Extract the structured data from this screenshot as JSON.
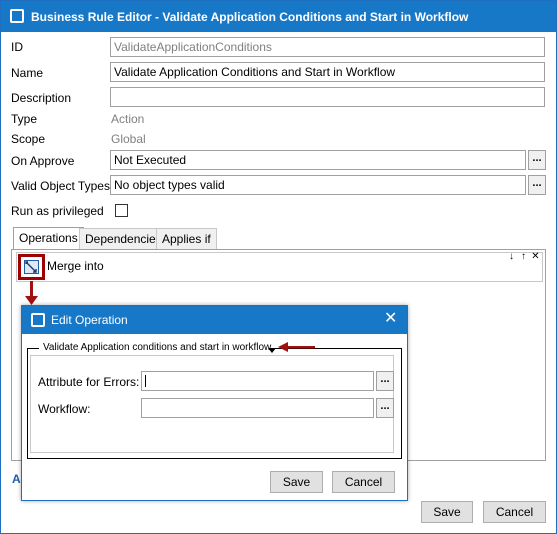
{
  "window": {
    "title": "Business Rule Editor - Validate Application Conditions and Start in Workflow"
  },
  "fields": {
    "id_label": "ID",
    "id_value": "ValidateApplicationConditions",
    "name_label": "Name",
    "name_value": "Validate Application Conditions and Start in Workflow",
    "description_label": "Description",
    "description_value": "",
    "type_label": "Type",
    "type_value": "Action",
    "scope_label": "Scope",
    "scope_value": "Global",
    "on_approve_label": "On Approve",
    "on_approve_value": "Not Executed",
    "valid_object_types_label": "Valid Object Types",
    "valid_object_types_value": "No object types valid",
    "run_privileged_label": "Run as privileged",
    "ellipsis": "..."
  },
  "tabs": [
    {
      "label": "Operations",
      "active": true
    },
    {
      "label": "Dependencies",
      "active": false
    },
    {
      "label": "Applies if",
      "active": false
    }
  ],
  "operations": {
    "row_text": "Merge  into",
    "move_down": "↓",
    "move_up": "↑",
    "remove": "✕",
    "add_link": "Ad"
  },
  "footer": {
    "save": "Save",
    "cancel": "Cancel"
  },
  "dialog": {
    "title": "Edit Operation",
    "close": "✕",
    "group_title": "Validate Application conditions and start in workflow",
    "attr_errors_label": "Attribute for Errors:",
    "attr_errors_value": "",
    "workflow_label": "Workflow:",
    "workflow_value": "",
    "ellipsis": "...",
    "save": "Save",
    "cancel": "Cancel"
  },
  "colors": {
    "titlebar": "#1878c8",
    "highlight": "#a00000"
  }
}
